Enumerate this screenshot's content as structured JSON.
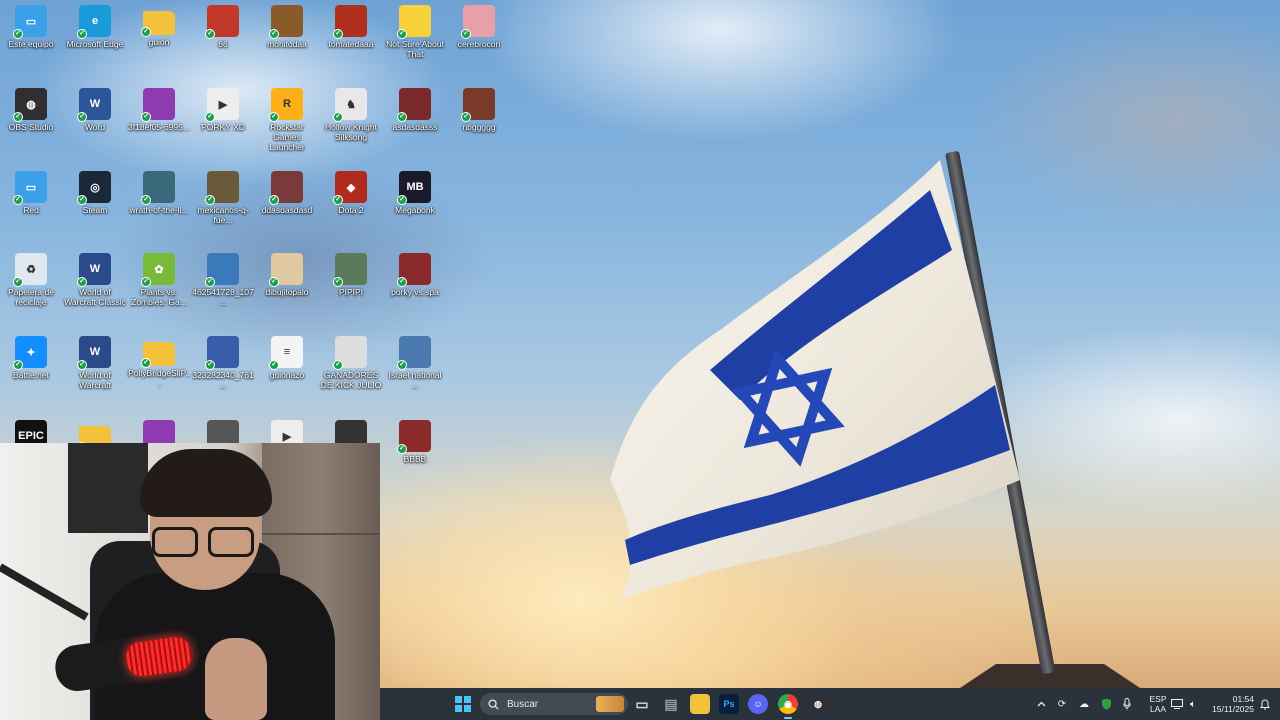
{
  "desktop": {
    "icons": [
      {
        "label": "Este equipo",
        "icon": "computer-icon",
        "color": "#3aa0e8"
      },
      {
        "label": "Microsoft Edge",
        "icon": "edge-icon",
        "color": "#1a9bd9"
      },
      {
        "label": "guion",
        "icon": "folder-icon",
        "color": "#f3c13a"
      },
      {
        "label": "66",
        "icon": "image-file-icon",
        "color": "#c0392b"
      },
      {
        "label": "monitodaa",
        "icon": "image-file-icon",
        "color": "#8b5a2b"
      },
      {
        "label": "tomatedaaa",
        "icon": "image-file-icon",
        "color": "#b03020"
      },
      {
        "label": "Not Sure About That",
        "icon": "duck-icon",
        "color": "#f7d23a"
      },
      {
        "label": "cerebrocori",
        "icon": "image-file-icon",
        "color": "#e8a0a8"
      },
      {
        "label": "OBS Studio",
        "icon": "obs-icon",
        "color": "#302e31"
      },
      {
        "label": "Word",
        "icon": "word-icon",
        "color": "#2b579a"
      },
      {
        "label": "3f18ef05-6995...",
        "icon": "file-icon",
        "color": "#8e3ab0"
      },
      {
        "label": "PORKY XD",
        "icon": "video-file-icon",
        "color": "#eeeeee"
      },
      {
        "label": "Rockstar Games Launcher",
        "icon": "rockstar-icon",
        "color": "#fcaf17"
      },
      {
        "label": "Hollow Knight Silksong",
        "icon": "hollow-knight-icon",
        "color": "#e8e8e8"
      },
      {
        "label": "asdasdasss",
        "icon": "image-file-icon",
        "color": "#7a2a2a"
      },
      {
        "label": "nbggggg",
        "icon": "image-file-icon",
        "color": "#7a3a2a"
      },
      {
        "label": "Red",
        "icon": "network-icon",
        "color": "#3aa0e8"
      },
      {
        "label": "Steam",
        "icon": "steam-icon",
        "color": "#1b2838"
      },
      {
        "label": "wrath-of-the-li...",
        "icon": "image-file-icon",
        "color": "#3a6a7a"
      },
      {
        "label": "mexicanos-q-fue...",
        "icon": "image-file-icon",
        "color": "#6a5a3a"
      },
      {
        "label": "ddasdasdasd",
        "icon": "image-file-icon",
        "color": "#7a3a3a"
      },
      {
        "label": "Dota 2",
        "icon": "dota-icon",
        "color": "#b02a1e"
      },
      {
        "label": "Megabonk",
        "icon": "megabonk-icon",
        "color": "#1a1a2a"
      },
      {
        "label": "Papelera de reciclaje",
        "icon": "recycle-bin-icon",
        "color": "#dfe8ef"
      },
      {
        "label": "World of Warcraft Classic",
        "icon": "wow-icon",
        "color": "#2a4a8a"
      },
      {
        "label": "Plants vs. Zombies: Ga...",
        "icon": "pvz-icon",
        "color": "#7aba3a"
      },
      {
        "label": "462541728_107...",
        "icon": "image-file-icon",
        "color": "#3a7aba"
      },
      {
        "label": "dibujitopalo",
        "icon": "image-file-icon",
        "color": "#e0c8a0"
      },
      {
        "label": "PIPIPI",
        "icon": "image-file-icon",
        "color": "#5a7a5a"
      },
      {
        "label": "porky vs spa",
        "icon": "image-file-icon",
        "color": "#8a2a2a"
      },
      {
        "label": "Battle.net",
        "icon": "battlenet-icon",
        "color": "#148eff"
      },
      {
        "label": "World of Warcraft",
        "icon": "wow-icon",
        "color": "#2a4a8a"
      },
      {
        "label": "PollyBridgeSliP...",
        "icon": "folder-icon",
        "color": "#f3c13a"
      },
      {
        "label": "323282340_761...",
        "icon": "image-file-icon",
        "color": "#3a5aaa"
      },
      {
        "label": "guionazo",
        "icon": "document-icon",
        "color": "#f4f4f4"
      },
      {
        "label": "GANADORES DE KICK JULIO",
        "icon": "image-file-icon",
        "color": "#dddddd"
      },
      {
        "label": "Israel national ...",
        "icon": "image-file-icon",
        "color": "#4a7ab0"
      },
      {
        "label": "Epic Games",
        "icon": "epic-games-icon",
        "color": "#111111"
      },
      {
        "label": "",
        "icon": "folder-icon",
        "color": "#f3c13a"
      },
      {
        "label": "",
        "icon": "file-icon",
        "color": "#8e3ab0"
      },
      {
        "label": "",
        "icon": "image-file-icon",
        "color": "#555555"
      },
      {
        "label": "",
        "icon": "video-file-icon",
        "color": "#eeeeee"
      },
      {
        "label": "",
        "icon": "image-file-icon",
        "color": "#333333"
      },
      {
        "label": "BBBB",
        "icon": "image-file-icon",
        "color": "#8a2a2a"
      }
    ]
  },
  "taskbar": {
    "search_placeholder": "Buscar",
    "apps": [
      {
        "name": "task-view",
        "icon": "task-view-icon",
        "color": "#d8d8d8",
        "glyph": "▭"
      },
      {
        "name": "printer",
        "icon": "printer-icon",
        "color": "#9a9a9a",
        "glyph": "▤"
      },
      {
        "name": "file-explorer",
        "icon": "folder-icon",
        "color": "#f3c13a",
        "glyph": ""
      },
      {
        "name": "photoshop",
        "icon": "photoshop-icon",
        "color": "#0a1f3a",
        "glyph": "Ps"
      },
      {
        "name": "discord",
        "icon": "discord-icon",
        "color": "#5865f2",
        "glyph": "☺"
      },
      {
        "name": "chrome",
        "icon": "chrome-icon",
        "color": "#e0e0e0",
        "glyph": "◉"
      },
      {
        "name": "obs",
        "icon": "obs-icon",
        "color": "#302e31",
        "glyph": "◍"
      }
    ],
    "language": {
      "line1": "ESP",
      "line2": "LAA"
    },
    "clock": {
      "time": "01:54",
      "date": "15/11/2025"
    }
  },
  "colors": {
    "flag_blue": "#1f3fa5",
    "flag_white": "#f4f1ea",
    "taskbar": "#20262e",
    "accent": "#4cc2ff"
  }
}
